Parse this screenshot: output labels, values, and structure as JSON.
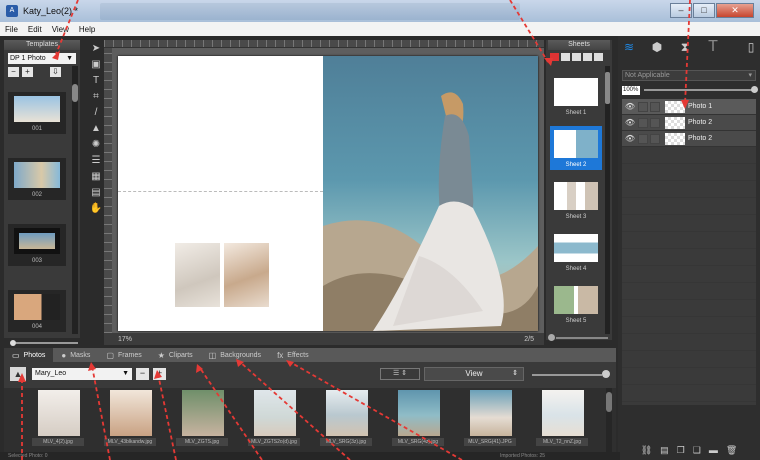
{
  "window": {
    "title": "Katy_Leo(2) *",
    "app_icon": "album-app-icon",
    "controls": [
      "minimize",
      "maximize",
      "close"
    ]
  },
  "menu": [
    "File",
    "Edit",
    "View",
    "Help"
  ],
  "templates": {
    "title": "Templates",
    "selected": "DP 1 Photo",
    "buttons": [
      "−",
      "+",
      "⇩"
    ],
    "items": [
      {
        "label": "001"
      },
      {
        "label": "002"
      },
      {
        "label": "003"
      },
      {
        "label": "004"
      }
    ]
  },
  "tools": [
    "select-tool",
    "crop-frame-tool",
    "text-tool",
    "crop-tool",
    "pen-tool",
    "stamp-tool",
    "sun-tool",
    "list-tool",
    "grid-tool",
    "layout-tool",
    "hand-tool"
  ],
  "canvas": {
    "zoom": "17%",
    "page": "2/5"
  },
  "sheets": {
    "title": "Sheets",
    "items": [
      {
        "label": "Sheet 1",
        "active": false
      },
      {
        "label": "Sheet 2",
        "active": true
      },
      {
        "label": "Sheet 3",
        "active": false
      },
      {
        "label": "Sheet 4",
        "active": false
      },
      {
        "label": "Sheet 5",
        "active": false
      }
    ]
  },
  "layers_panel": {
    "icons": [
      "layers-icon",
      "cube-icon",
      "adjust-icon",
      "text-icon",
      "panel-icon"
    ],
    "blend_mode": "Not Applicable",
    "opacity": "100%",
    "layers": [
      {
        "name": "Photo 1"
      },
      {
        "name": "Photo 2"
      },
      {
        "name": "Photo 2"
      }
    ],
    "bottom_icons": [
      "link-icon",
      "sheet-icon",
      "copy-icon",
      "stack-icon",
      "align-icon",
      "trash-icon"
    ]
  },
  "bottom_tabs": [
    {
      "label": "Photos",
      "icon": "photo-icon",
      "active": true
    },
    {
      "label": "Masks",
      "icon": "circle-icon",
      "active": false
    },
    {
      "label": "Frames",
      "icon": "frame-icon",
      "active": false
    },
    {
      "label": "Cliparts",
      "icon": "star-icon",
      "active": false
    },
    {
      "label": "Backgrounds",
      "icon": "background-icon",
      "active": false
    },
    {
      "label": "Effects",
      "icon": "fx-icon",
      "active": false
    }
  ],
  "photos_toolbar": {
    "album": "Mary_Leo",
    "view": "View"
  },
  "photos": [
    {
      "label": "MLV_4(2).jpg"
    },
    {
      "label": "MLV_43blkandw.jpg"
    },
    {
      "label": "MLV_ZGTS.jpg"
    },
    {
      "label": "MLV_ZGTS2o(d).jpg"
    },
    {
      "label": "MLV_SRG(3z).jpg"
    },
    {
      "label": "MLV_SRG(4z).jpg"
    },
    {
      "label": "MLV_SRG(41).JPG"
    },
    {
      "label": "MLV_T2_nnZ.jpg"
    }
  ],
  "status": {
    "left": "Selected Photo: 0",
    "right": "Imported Photos: 25"
  },
  "colors": {
    "accent": "#1e78d8",
    "annotation": "#e53935"
  }
}
